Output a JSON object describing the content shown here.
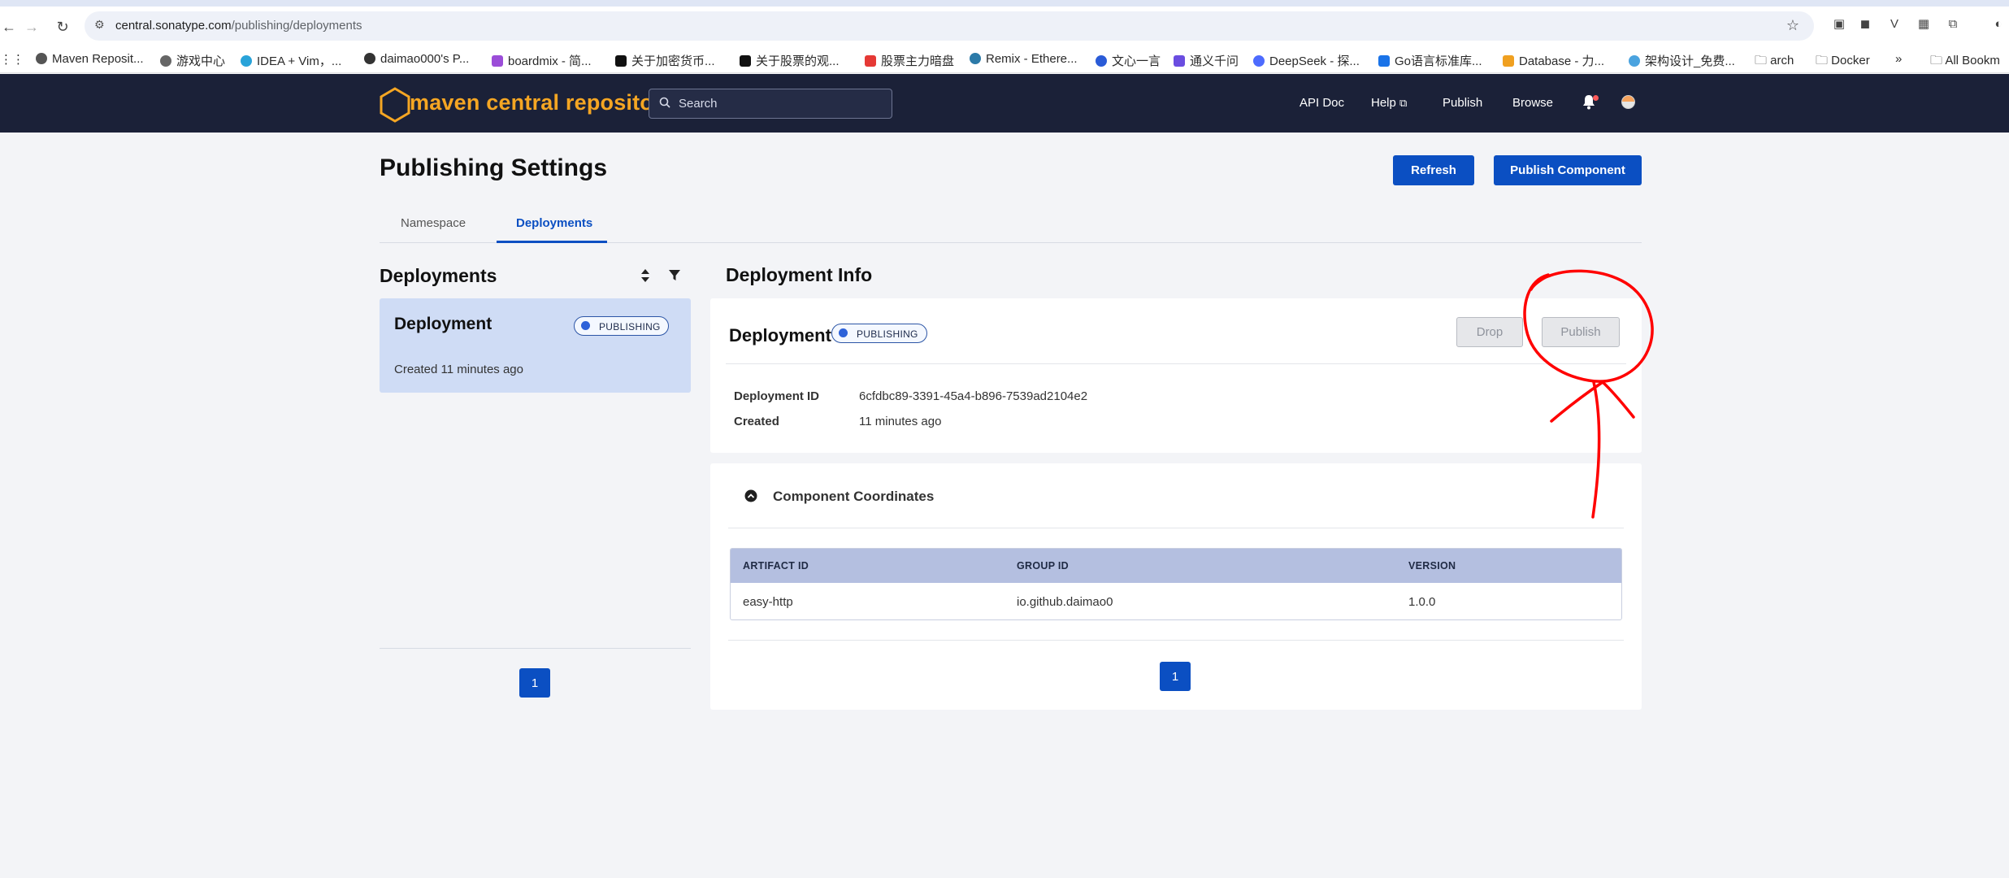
{
  "browser": {
    "url_host": "central.sonatype.com",
    "url_path": "/publishing/deployments",
    "bookmarks": [
      "Maven Reposit...",
      "游戏中心",
      "IDEA + Vim，...",
      "daimao000's P...",
      "boardmix - 简...",
      "关于加密货币...",
      "关于股票的观...",
      "股票主力暗盘",
      "Remix - Ethere...",
      "文心一言",
      "通义千问",
      "DeepSeek - 探...",
      "Go语言标准库...",
      "Database - 力...",
      "架构设计_免费...",
      "arch",
      "Docker",
      "»",
      "All Bookm"
    ]
  },
  "header": {
    "logo_text": "maven central repository",
    "search_placeholder": "Search",
    "nav": {
      "api_doc": "API Doc",
      "help": "Help",
      "publish": "Publish",
      "browse": "Browse"
    }
  },
  "page": {
    "title": "Publishing Settings",
    "refresh_label": "Refresh",
    "publish_component_label": "Publish Component",
    "tabs": [
      "Namespace",
      "Deployments"
    ],
    "active_tab": "Deployments"
  },
  "deployments_list": {
    "title": "Deployments",
    "items": [
      {
        "name": "Deployment",
        "status": "PUBLISHING",
        "created": "Created 11 minutes ago"
      }
    ],
    "pagination": {
      "current": "1"
    }
  },
  "deployment_info": {
    "title": "Deployment Info",
    "name": "Deployment",
    "status": "PUBLISHING",
    "drop_label": "Drop",
    "publish_label": "Publish",
    "fields": [
      {
        "label": "Deployment ID",
        "value": "6cfdbc89-3391-45a4-b896-7539ad2104e2"
      },
      {
        "label": "Created",
        "value": "11 minutes ago"
      }
    ],
    "component_coordinates": {
      "title": "Component Coordinates",
      "columns": [
        "ARTIFACT ID",
        "GROUP ID",
        "VERSION"
      ],
      "rows": [
        [
          "easy-http",
          "io.github.daimao0",
          "1.0.0"
        ]
      ]
    },
    "pagination": {
      "current": "1"
    }
  },
  "colors": {
    "brand_orange": "#f5a623",
    "header_bg": "#1b2138",
    "primary_blue": "#0b4fc2",
    "annotation_red": "#ff0000"
  }
}
